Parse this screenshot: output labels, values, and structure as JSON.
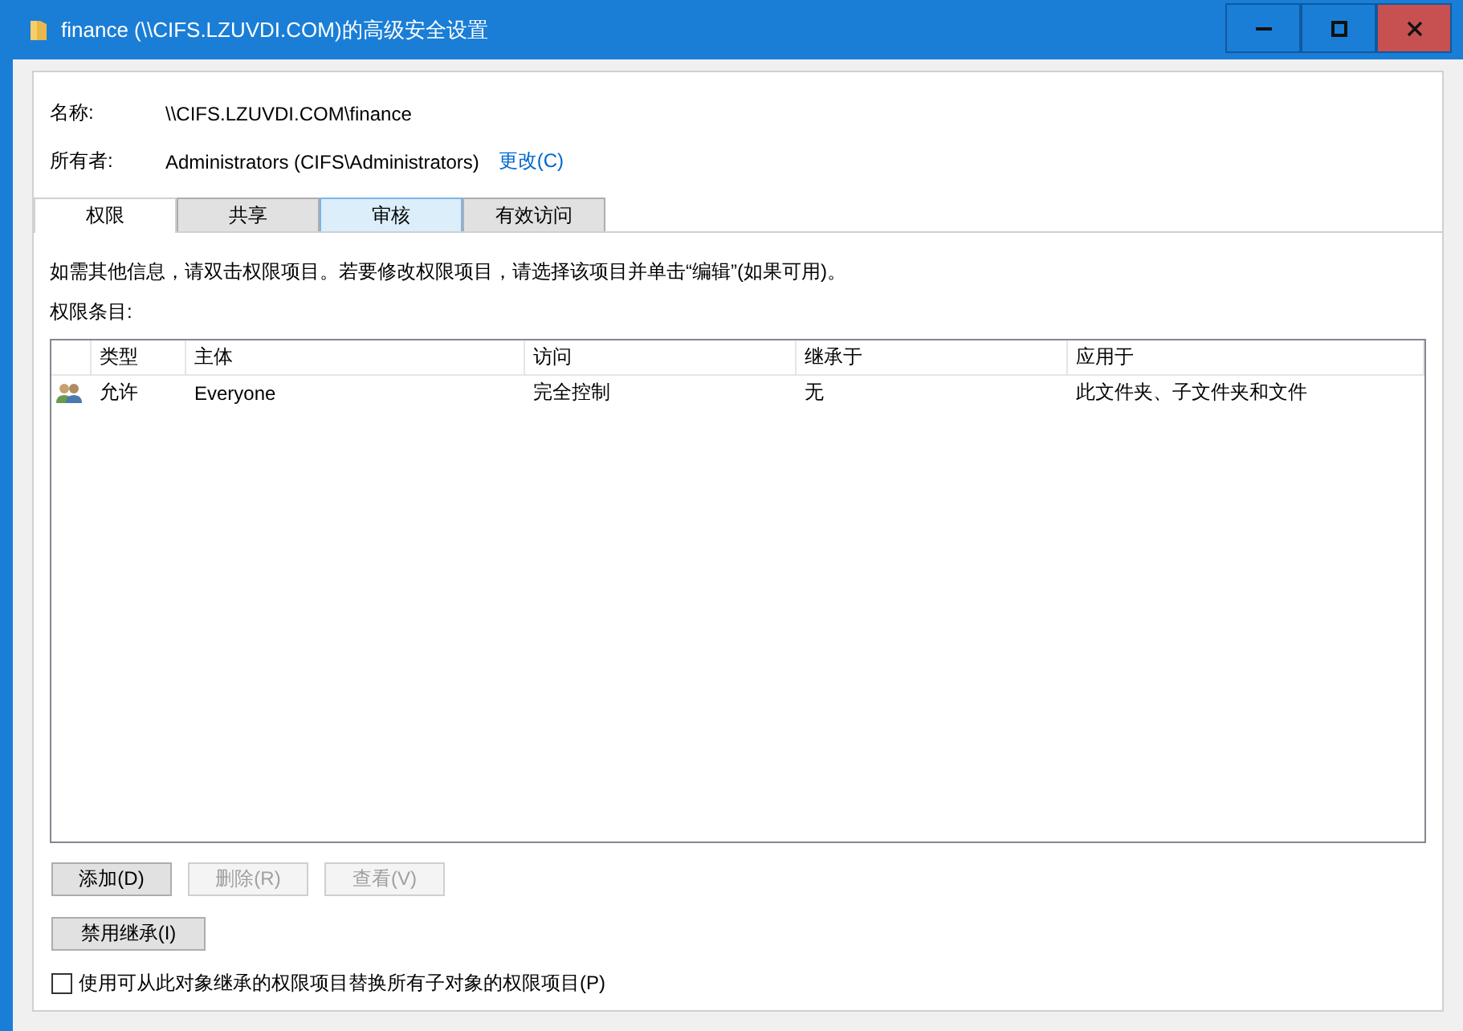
{
  "window": {
    "title": "finance (\\\\CIFS.LZUVDI.COM)的高级安全设置"
  },
  "fields": [
    {
      "label": "名称:",
      "value": "\\\\CIFS.LZUVDI.COM\\finance"
    },
    {
      "label": "所有者:",
      "value": "Administrators (CIFS\\Administrators)",
      "link": "更改(C)"
    }
  ],
  "tabs": [
    {
      "label": "权限",
      "selected": true,
      "hovered": false
    },
    {
      "label": "共享",
      "selected": false,
      "hovered": false
    },
    {
      "label": "审核",
      "selected": false,
      "hovered": true
    },
    {
      "label": "有效访问",
      "selected": false,
      "hovered": false
    }
  ],
  "info": "如需其他信息，请双击权限项目。若要修改权限项目，请选择该项目并单击“编辑”(如果可用)。",
  "list_label": "权限条目:",
  "table": {
    "columns": [
      "类型",
      "主体",
      "访问",
      "继承于",
      "应用于"
    ],
    "rows": [
      {
        "cells": [
          "允许",
          "Everyone",
          "完全控制",
          "无",
          "此文件夹、子文件夹和文件"
        ]
      }
    ]
  },
  "buttons": [
    {
      "label": "添加(D)",
      "disabled": false
    },
    {
      "label": "删除(R)",
      "disabled": true
    },
    {
      "label": "查看(V)",
      "disabled": true
    }
  ],
  "inherit_button": {
    "label": "禁用继承(I)",
    "disabled": false
  },
  "replace_checkbox": {
    "label": "使用可从此对象继承的权限项目替换所有子对象的权限项目(P)",
    "checked": false
  }
}
